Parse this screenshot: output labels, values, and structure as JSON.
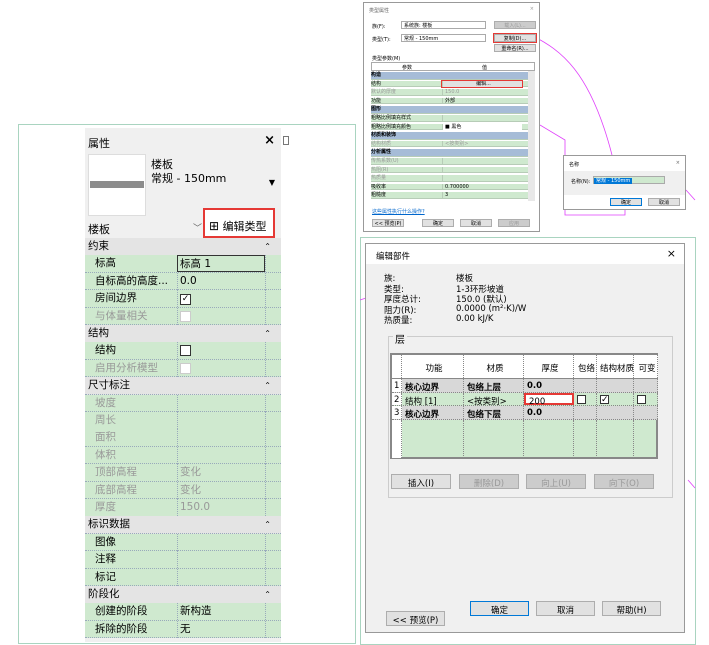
{
  "properties_panel": {
    "title": "属性",
    "close": "×",
    "family": "楼板",
    "type": "常规 - 150mm",
    "selector": "楼板",
    "edit_type": "编辑类型",
    "rows": [
      {
        "kind": "h",
        "label": "约束"
      },
      {
        "label": "标高",
        "value": "标高 1",
        "boxed": true
      },
      {
        "label": "自标高的高度...",
        "value": "0.0"
      },
      {
        "label": "房间边界",
        "check": "checked"
      },
      {
        "label": "与体量相关",
        "check": "grey",
        "disabled": true
      },
      {
        "kind": "h",
        "label": "结构"
      },
      {
        "label": "结构",
        "check": "empty"
      },
      {
        "label": "启用分析模型",
        "check": "grey",
        "disabled": true
      },
      {
        "kind": "h",
        "label": "尺寸标注"
      },
      {
        "label": "坡度",
        "disabled": true
      },
      {
        "label": "周长",
        "disabled": true
      },
      {
        "label": "面积",
        "disabled": true
      },
      {
        "label": "体积",
        "disabled": true
      },
      {
        "label": "顶部高程",
        "value": "变化",
        "disabled": true
      },
      {
        "label": "底部高程",
        "value": "变化",
        "disabled": true
      },
      {
        "label": "厚度",
        "value": "150.0",
        "disabled": true
      },
      {
        "kind": "h",
        "label": "标识数据"
      },
      {
        "label": "图像"
      },
      {
        "label": "注释"
      },
      {
        "label": "标记"
      },
      {
        "kind": "h",
        "label": "阶段化"
      },
      {
        "label": "创建的阶段",
        "value": "新构造"
      },
      {
        "label": "拆除的阶段",
        "value": "无"
      }
    ]
  },
  "type_properties": {
    "title": "类型属性",
    "family_label": "族(F):",
    "family_value": "系统族: 楼板",
    "type_label": "类型(T):",
    "type_value": "常规 - 150mm",
    "load": "载入(L)...",
    "duplicate": "复制(D)...",
    "rename": "重命名(R)...",
    "params_label": "类型参数(M)",
    "col_param": "参数",
    "col_value": "值",
    "rows": [
      {
        "kind": "h",
        "label": "构造"
      },
      {
        "label": "结构",
        "value": "编辑...",
        "button": true
      },
      {
        "label": "默认的厚度",
        "value": "150.0",
        "disabled": true
      },
      {
        "label": "功能",
        "value": "外部"
      },
      {
        "kind": "h",
        "label": "图形"
      },
      {
        "label": "粗略比例填充样式",
        "value": ""
      },
      {
        "label": "粗略比例填充颜色",
        "value": "黑色",
        "swatch": true
      },
      {
        "kind": "h",
        "label": "材质和装饰"
      },
      {
        "label": "结构材质",
        "value": "<按类别>",
        "disabled": true
      },
      {
        "kind": "h",
        "label": "分析属性"
      },
      {
        "label": "传热系数(U)",
        "value": "",
        "disabled": true
      },
      {
        "label": "热阻(R)",
        "value": "",
        "disabled": true
      },
      {
        "label": "热质量",
        "value": "",
        "disabled": true
      },
      {
        "label": "吸收率",
        "value": "0.700000"
      },
      {
        "label": "粗糙度",
        "value": "3"
      }
    ],
    "help_link": "这些属性执行什么操作?",
    "preview": "<< 预览(P)",
    "ok": "确定",
    "cancel": "取消",
    "apply": "应用"
  },
  "rename_dialog": {
    "title": "名称",
    "name_label": "名称(N):",
    "name_value": "常规 - 150mm",
    "ok": "确定",
    "cancel": "取消"
  },
  "edit_assembly": {
    "title": "编辑部件",
    "close": "×",
    "info": [
      {
        "label": "族:",
        "value": "楼板"
      },
      {
        "label": "类型:",
        "value": "1-3环形坡道"
      },
      {
        "label": "厚度总计:",
        "value": "150.0 (默认)"
      },
      {
        "label": "阻力(R):",
        "value": "0.0000 (m²·K)/W"
      },
      {
        "label": "热质量:",
        "value": "0.00 kJ/K"
      }
    ],
    "layers_label": "层",
    "columns": [
      "功能",
      "材质",
      "厚度",
      "包络",
      "结构材质",
      "可变"
    ],
    "layers": [
      {
        "num": "1",
        "function": "核心边界",
        "material": "包络上层",
        "thickness": "0.0",
        "kind": "core"
      },
      {
        "num": "2",
        "function": "结构 [1]",
        "material": "<按类别>",
        "thickness": "200",
        "kind": "layer",
        "wrap": false,
        "structural": true,
        "variable": false
      },
      {
        "num": "3",
        "function": "核心边界",
        "material": "包络下层",
        "thickness": "0.0",
        "kind": "core"
      }
    ],
    "insert": "插入(I)",
    "delete": "删除(D)",
    "up": "向上(U)",
    "down": "向下(O)",
    "ok": "确定",
    "cancel": "取消",
    "help": "帮助(H)",
    "preview": "<< 预览(P)"
  },
  "colors": {
    "highlight": "#e53935",
    "annotation": "#e040fb",
    "row_green": "#cfe9cf",
    "header_blue": "#a6bcd7"
  }
}
